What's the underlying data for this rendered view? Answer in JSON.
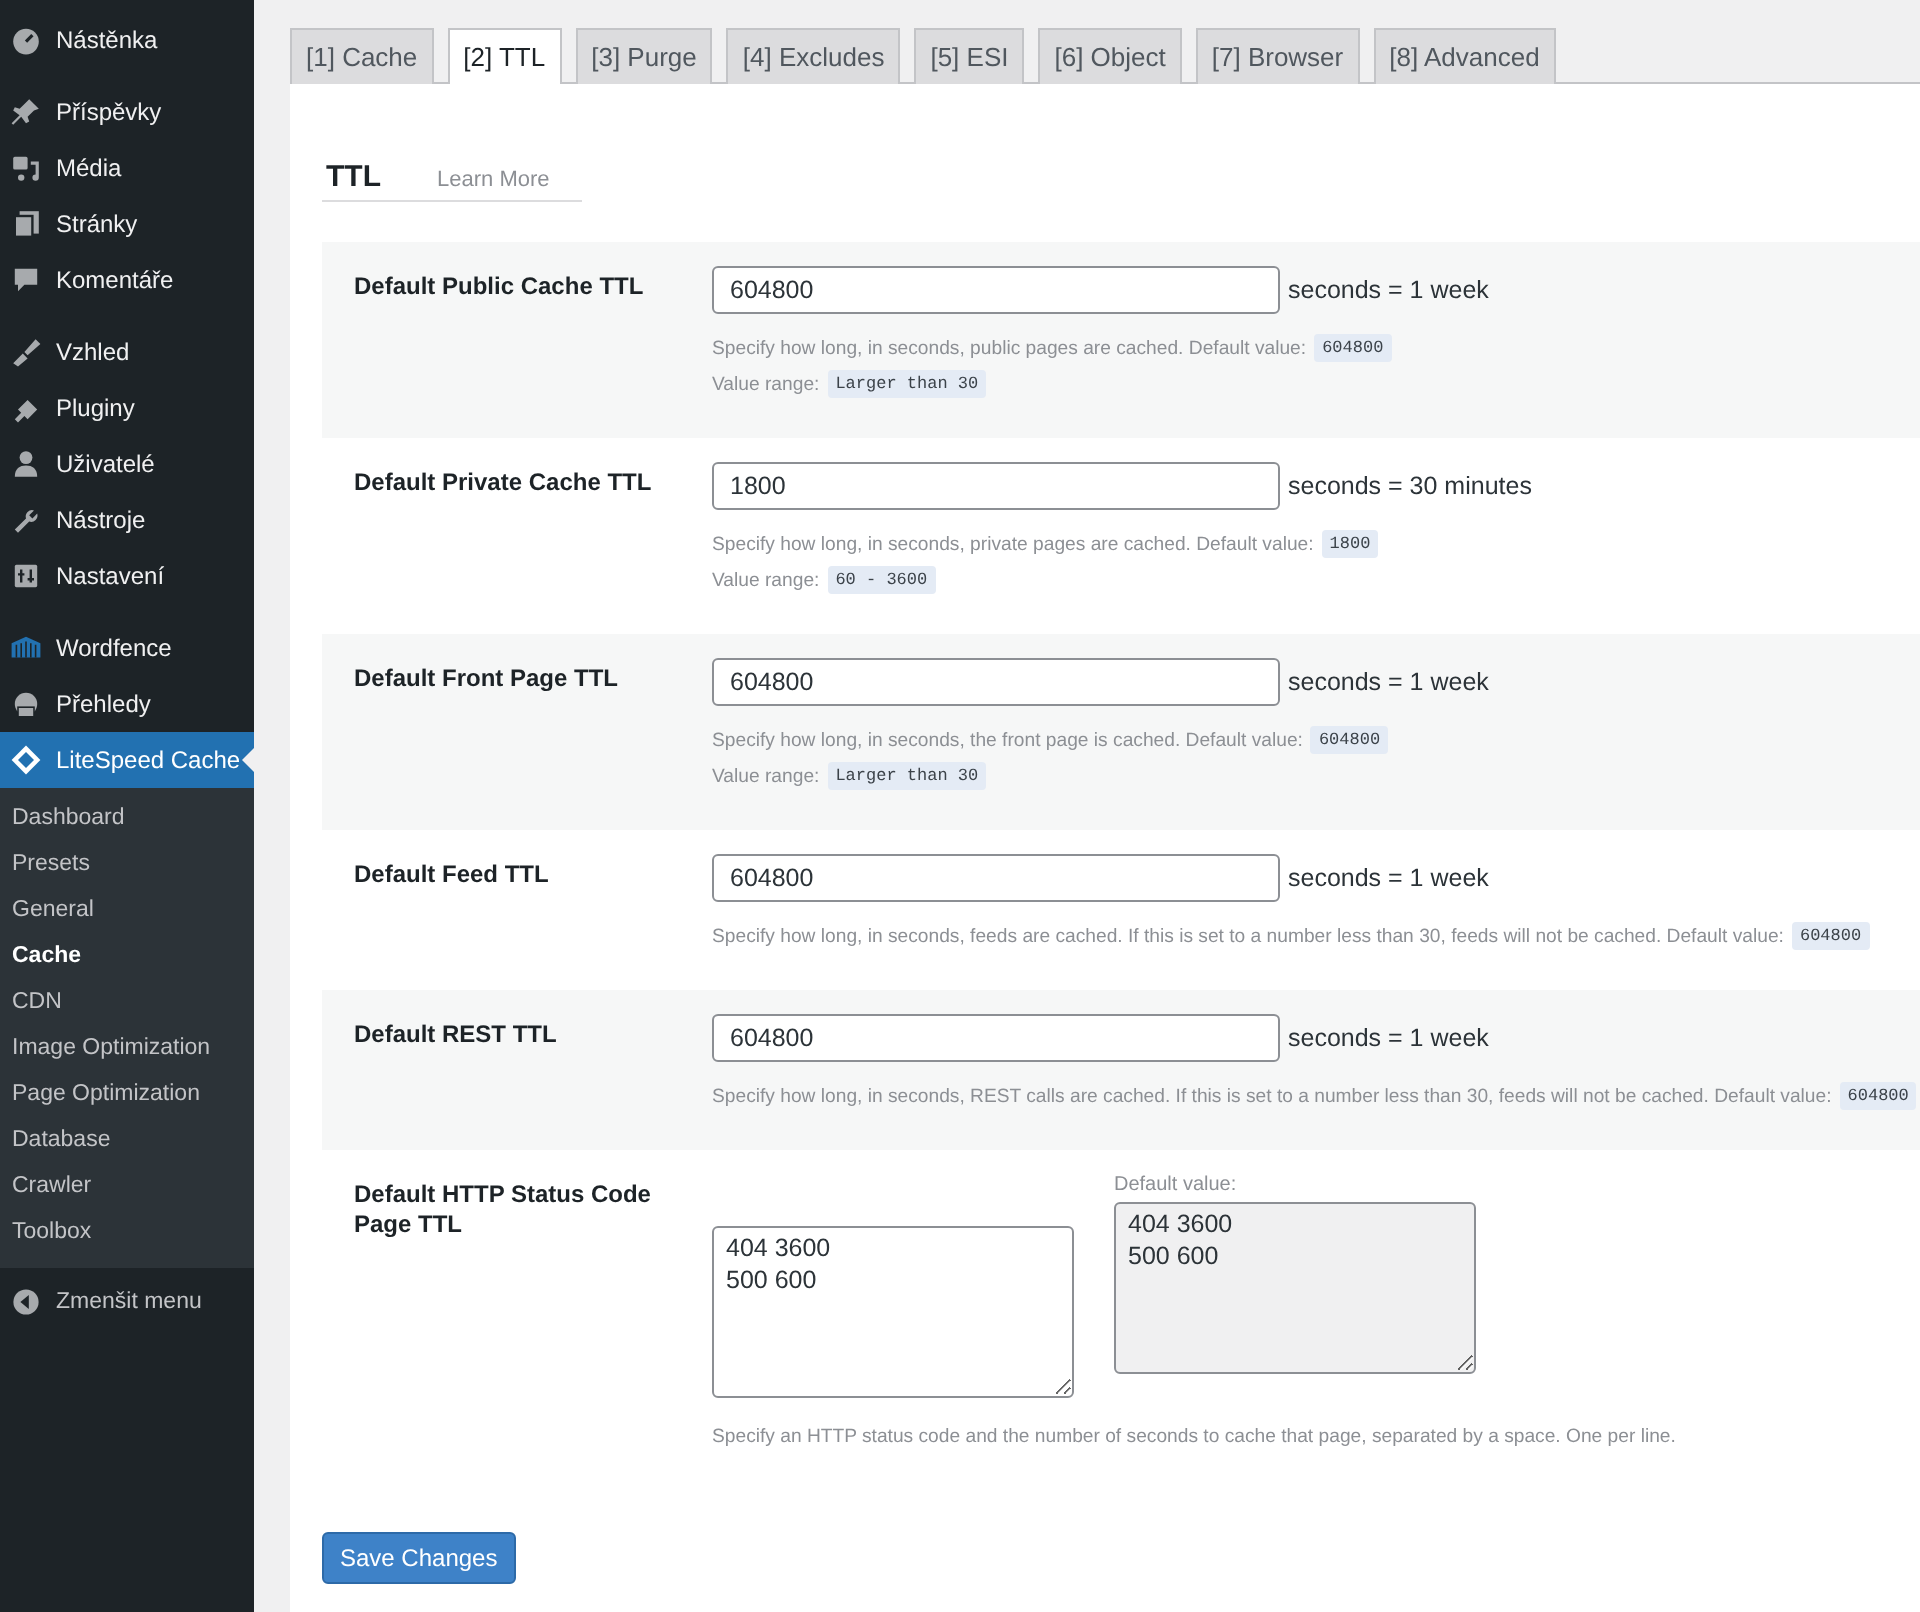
{
  "sidebar": {
    "groups": [
      [
        {
          "label": "Nástěnka",
          "selected": false
        }
      ],
      [
        {
          "label": "Příspěvky",
          "selected": false
        },
        {
          "label": "Média",
          "selected": false
        },
        {
          "label": "Stránky",
          "selected": false
        },
        {
          "label": "Komentáře",
          "selected": false
        }
      ],
      [
        {
          "label": "Vzhled",
          "selected": false
        },
        {
          "label": "Pluginy",
          "selected": false
        },
        {
          "label": "Uživatelé",
          "selected": false
        },
        {
          "label": "Nástroje",
          "selected": false
        },
        {
          "label": "Nastavení",
          "selected": false
        }
      ],
      [
        {
          "label": "Wordfence",
          "selected": false
        },
        {
          "label": "Přehledy",
          "selected": false
        },
        {
          "label": "LiteSpeed Cache",
          "selected": true
        }
      ]
    ],
    "submenu": [
      {
        "label": "Dashboard",
        "selected": false
      },
      {
        "label": "Presets",
        "selected": false
      },
      {
        "label": "General",
        "selected": false
      },
      {
        "label": "Cache",
        "selected": true
      },
      {
        "label": "CDN",
        "selected": false
      },
      {
        "label": "Image Optimization",
        "selected": false
      },
      {
        "label": "Page Optimization",
        "selected": false
      },
      {
        "label": "Database",
        "selected": false
      },
      {
        "label": "Crawler",
        "selected": false
      },
      {
        "label": "Toolbox",
        "selected": false
      }
    ],
    "collapse": "Zmenšit menu"
  },
  "tabs": [
    {
      "label": "[1] Cache",
      "selected": false
    },
    {
      "label": "[2] TTL",
      "selected": true
    },
    {
      "label": "[3] Purge",
      "selected": false
    },
    {
      "label": "[4] Excludes",
      "selected": false
    },
    {
      "label": "[5] ESI",
      "selected": false
    },
    {
      "label": "[6] Object",
      "selected": false
    },
    {
      "label": "[7] Browser",
      "selected": false
    },
    {
      "label": "[8] Advanced",
      "selected": false
    }
  ],
  "section": {
    "title": "TTL",
    "link": "Learn More"
  },
  "settings": [
    {
      "kind": "input",
      "label": "Default Public Cache TTL",
      "value": "604800",
      "unit": "seconds = 1 week",
      "notes": [
        {
          "text": "Specify how long, in seconds, public pages are cached. Default value:",
          "code": "604800"
        },
        {
          "text": "Value range:",
          "code": "Larger than 30"
        }
      ]
    },
    {
      "kind": "input",
      "label": "Default Private Cache TTL",
      "value": "1800",
      "unit": "seconds = 30 minutes",
      "notes": [
        {
          "text": "Specify how long, in seconds, private pages are cached. Default value:",
          "code": "1800"
        },
        {
          "text": "Value range:",
          "code": "60 - 3600"
        }
      ]
    },
    {
      "kind": "input",
      "label": "Default Front Page TTL",
      "value": "604800",
      "unit": "seconds = 1 week",
      "notes": [
        {
          "text": "Specify how long, in seconds, the front page is cached. Default value:",
          "code": "604800"
        },
        {
          "text": "Value range:",
          "code": "Larger than 30"
        }
      ]
    },
    {
      "kind": "input",
      "label": "Default Feed TTL",
      "value": "604800",
      "unit": "seconds = 1 week",
      "notes": [
        {
          "text": "Specify how long, in seconds, feeds are cached. If this is set to a number less than 30, feeds will not be cached. Default value:",
          "code": "604800"
        }
      ]
    },
    {
      "kind": "input",
      "label": "Default REST TTL",
      "value": "604800",
      "unit": "seconds = 1 week",
      "notes": [
        {
          "text": "Specify how long, in seconds, REST calls are cached. If this is set to a number less than 30, feeds will not be cached. Default value:",
          "code": "604800"
        }
      ]
    },
    {
      "kind": "textarea",
      "label": "Default HTTP Status Code Page TTL",
      "value": "404 3600\n500 600",
      "default_label": "Default value:",
      "default_value": "404 3600\n500 600",
      "notes": [
        {
          "text": "Specify an HTTP status code and the number of seconds to cache that page, separated by a space. One per line."
        }
      ]
    }
  ],
  "save_button": "Save Changes"
}
